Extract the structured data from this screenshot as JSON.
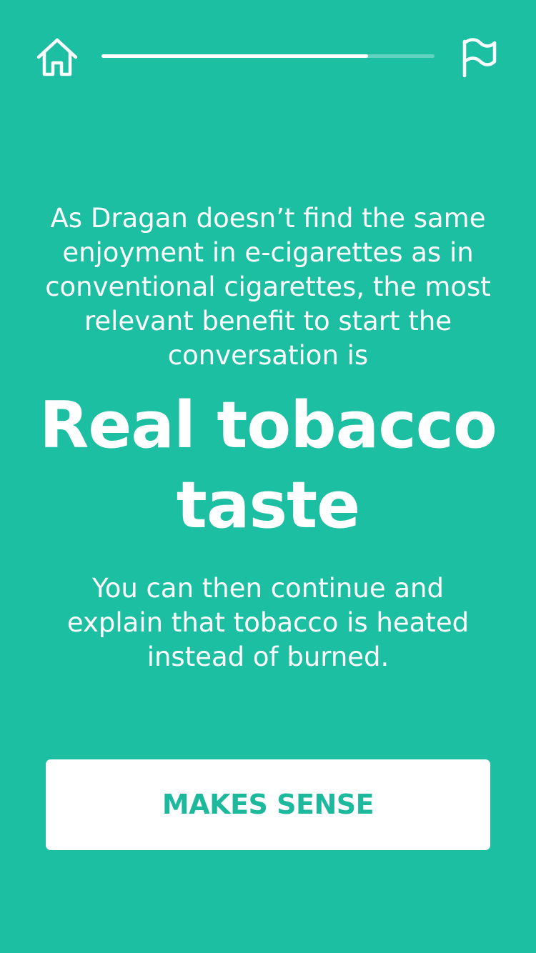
{
  "nav": {
    "home_icon": "home-icon",
    "flag_icon": "flag-icon",
    "progress": 0.8
  },
  "main": {
    "intro": "As Dragan doesn’t find the same enjoyment in e-cigarettes as in conventional cigarettes, the most relevant benefit to start the conversation is",
    "headline": "Real tobacco taste",
    "followup": "You can then continue and explain that tobacco is heated instead of burned."
  },
  "cta": {
    "label": "MAKES SENSE"
  },
  "colors": {
    "background": "#1dbfa3",
    "accent_text": "#1db99d",
    "foreground": "#ffffff"
  }
}
